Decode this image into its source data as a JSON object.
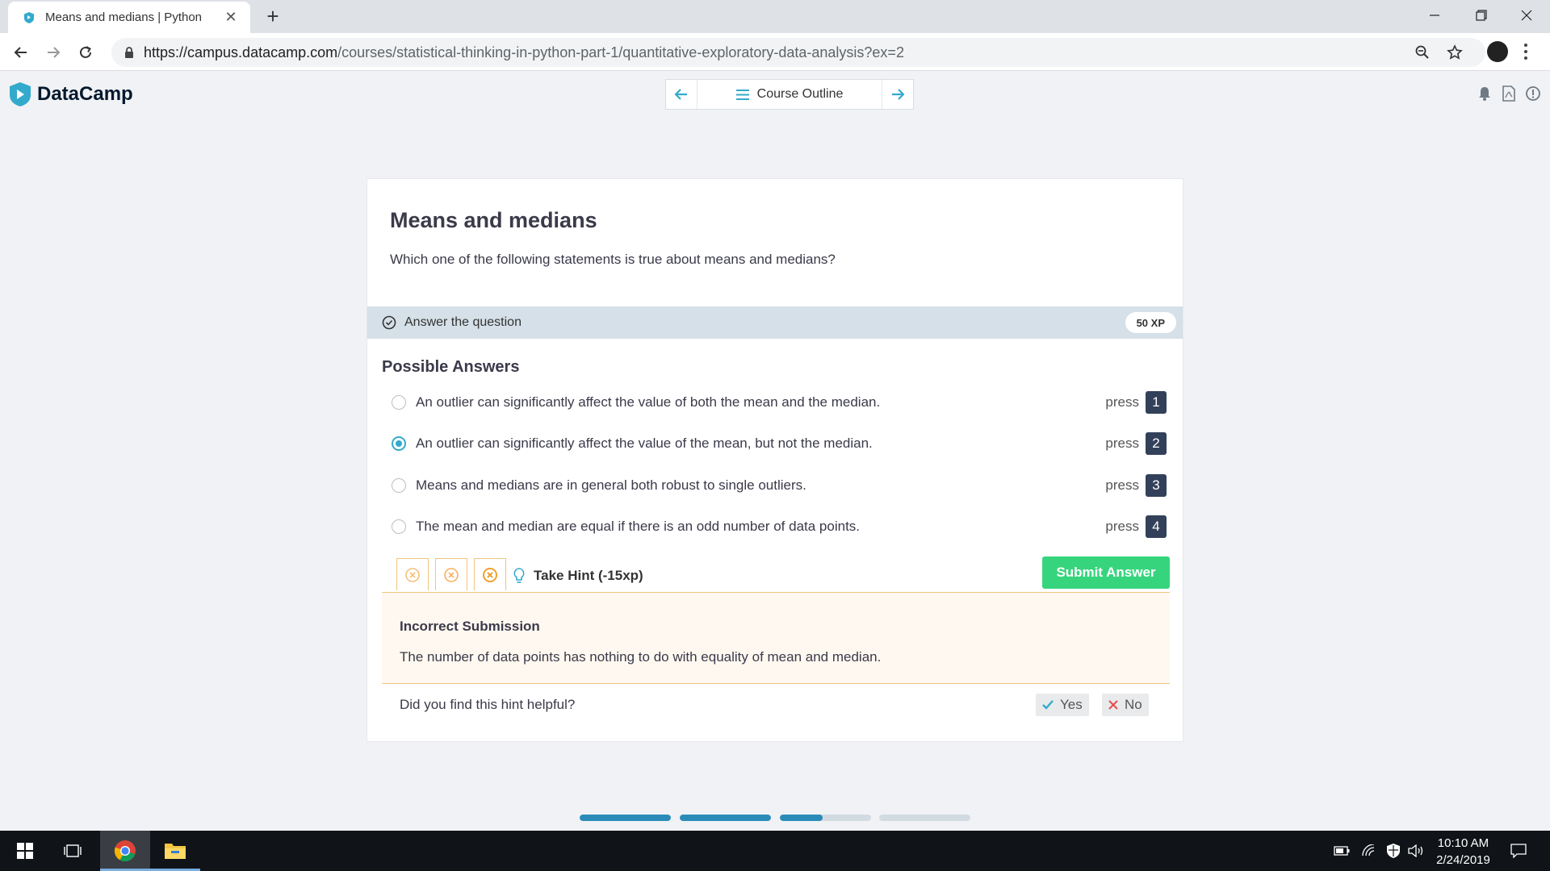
{
  "browser": {
    "tab_title": "Means and medians | Python",
    "url_host": "https://campus.datacamp.com",
    "url_path": "/courses/statistical-thinking-in-python-part-1/quantitative-exploratory-data-analysis?ex=2"
  },
  "header": {
    "brand": "DataCamp",
    "course_outline_label": "Course Outline"
  },
  "exercise": {
    "title": "Means and medians",
    "question": "Which one of the following statements is true about means and medians?",
    "task_label": "Answer the question",
    "xp": "50 XP",
    "answers_title": "Possible Answers",
    "answers": [
      {
        "text": "An outlier can significantly affect the value of both the mean and the median.",
        "press": "press",
        "key": "1",
        "selected": false
      },
      {
        "text": "An outlier can significantly affect the value of the mean, but not the median.",
        "press": "press",
        "key": "2",
        "selected": true
      },
      {
        "text": "Means and medians are in general both robust to single outliers.",
        "press": "press",
        "key": "3",
        "selected": false
      },
      {
        "text": "The mean and median are equal if there is an odd number of data points.",
        "press": "press",
        "key": "4",
        "selected": false
      }
    ],
    "hint_label": "Take Hint (-15xp)",
    "submit_label": "Submit Answer",
    "feedback_title": "Incorrect Submission",
    "feedback_text": "The number of data points has nothing to do with equality of mean and median.",
    "helpful_question": "Did you find this hint helpful?",
    "yes_label": "Yes",
    "no_label": "No"
  },
  "progress": [
    1.0,
    1.0,
    0.47,
    0.0
  ],
  "taskbar": {
    "time": "10:10 AM",
    "date": "2/24/2019"
  },
  "colors": {
    "accent_blue": "#33aacc",
    "submit_green": "#36d57d",
    "hint_orange": "#f0a030",
    "key_bg": "#33405a"
  }
}
